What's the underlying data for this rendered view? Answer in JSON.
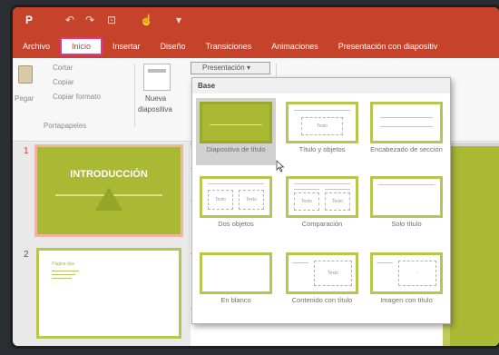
{
  "quick_access": {
    "app_icon": "P",
    "undo": "↶",
    "redo": "↷",
    "slideshow": "⊡",
    "touch": "☝",
    "more": "▾"
  },
  "tabs": [
    {
      "label": "Archivo",
      "active": false
    },
    {
      "label": "Inicio",
      "active": true
    },
    {
      "label": "Insertar",
      "active": false
    },
    {
      "label": "Diseño",
      "active": false
    },
    {
      "label": "Transiciones",
      "active": false
    },
    {
      "label": "Animaciones",
      "active": false
    },
    {
      "label": "Presentación con diapositiv",
      "active": false
    }
  ],
  "ribbon": {
    "cut": "Cortar",
    "copy": "Copiar",
    "format_painter": "Copiar formato",
    "paste": "Pegar",
    "clipboard_group": "Portapapeles",
    "new_slide_line1": "Nueva",
    "new_slide_line2": "diapositiva",
    "layout_dropdown": "Presentación"
  },
  "gallery": {
    "header": "Base",
    "placeholder_text": "Texto",
    "layouts": [
      "Diapositiva de título",
      "Título y objetos",
      "Encabezado de sección",
      "Dos objetos",
      "Comparación",
      "Solo título",
      "En blanco",
      "Contenido con título",
      "Imagen con título"
    ]
  },
  "slides": [
    {
      "number": "1",
      "title": "INTRODUCCIÓN"
    },
    {
      "number": "2",
      "title": "Página dos"
    }
  ],
  "colors": {
    "accent_red": "#c5432b",
    "theme_green": "#a9b934",
    "tab_highlight": "#e8338f"
  }
}
